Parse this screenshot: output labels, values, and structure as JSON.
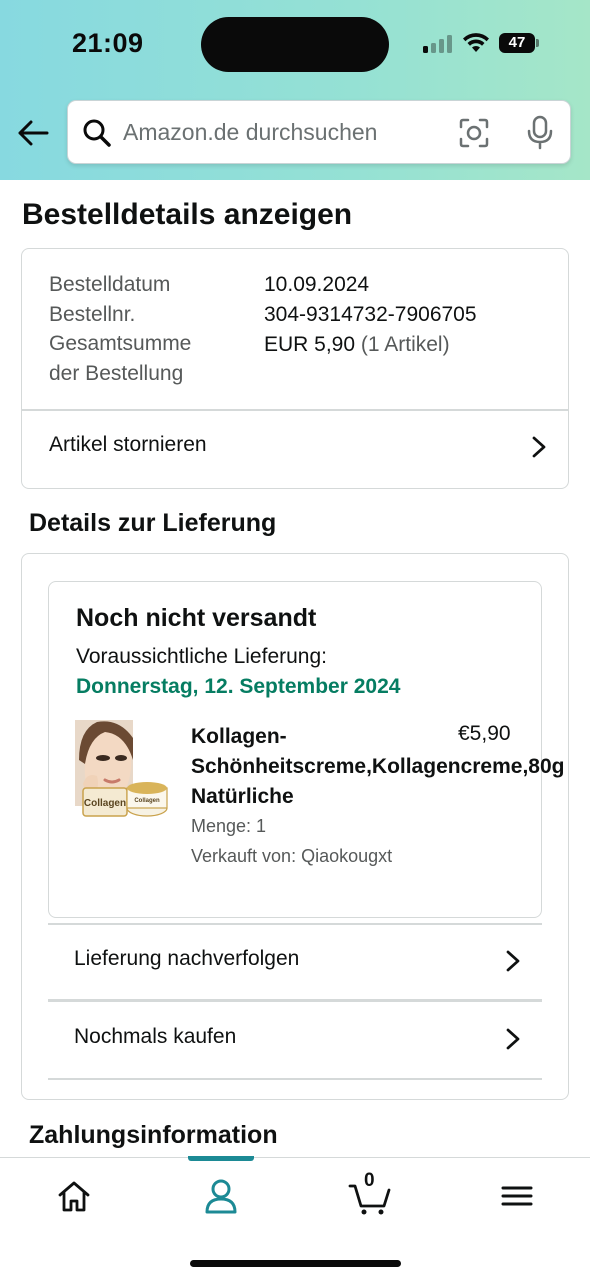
{
  "status_bar": {
    "time": "21:09",
    "battery": "47"
  },
  "search": {
    "placeholder": "Amazon.de durchsuchen"
  },
  "page": {
    "title": "Bestelldetails anzeigen"
  },
  "order_summary": {
    "rows": [
      {
        "label": "Bestelldatum",
        "value": "10.09.2024"
      },
      {
        "label": "Bestellnr.",
        "value": "304-9314732-7906705"
      },
      {
        "label": "Gesamtsumme der Bestellung",
        "value": "EUR 5,90",
        "note": "(1 Artikel)"
      }
    ],
    "cancel_label": "Artikel stornieren"
  },
  "delivery": {
    "section_title": "Details zur Lieferung",
    "status": "Noch nicht versandt",
    "expected_label": "Voraussichtliche Lieferung:",
    "expected_date": "Donnerstag, 12. September 2024",
    "product": {
      "title_line1": "Kollagen-",
      "title_line2": "Schönheitscreme,Kollagencreme,80g",
      "title_line3": "Natürliche",
      "price": "€5,90",
      "quantity": "Menge: 1",
      "seller": "Verkauft von: Qiaokougxt",
      "image_text": "Collagen"
    },
    "track_label": "Lieferung nachverfolgen",
    "buy_again_label": "Nochmals kaufen"
  },
  "payment": {
    "section_title": "Zahlungsinformation"
  },
  "tabbar": {
    "tabs": [
      {
        "name": "home",
        "icon": "home-icon"
      },
      {
        "name": "account",
        "icon": "person-icon",
        "active": true
      },
      {
        "name": "cart",
        "icon": "cart-icon",
        "count": "0"
      },
      {
        "name": "menu",
        "icon": "menu-icon"
      }
    ],
    "accent_color": "#1c8a95"
  },
  "colors": {
    "header_gradient_start": "#87d9e0",
    "header_gradient_end": "#a5e6c8",
    "delivery_green": "#067d62"
  }
}
